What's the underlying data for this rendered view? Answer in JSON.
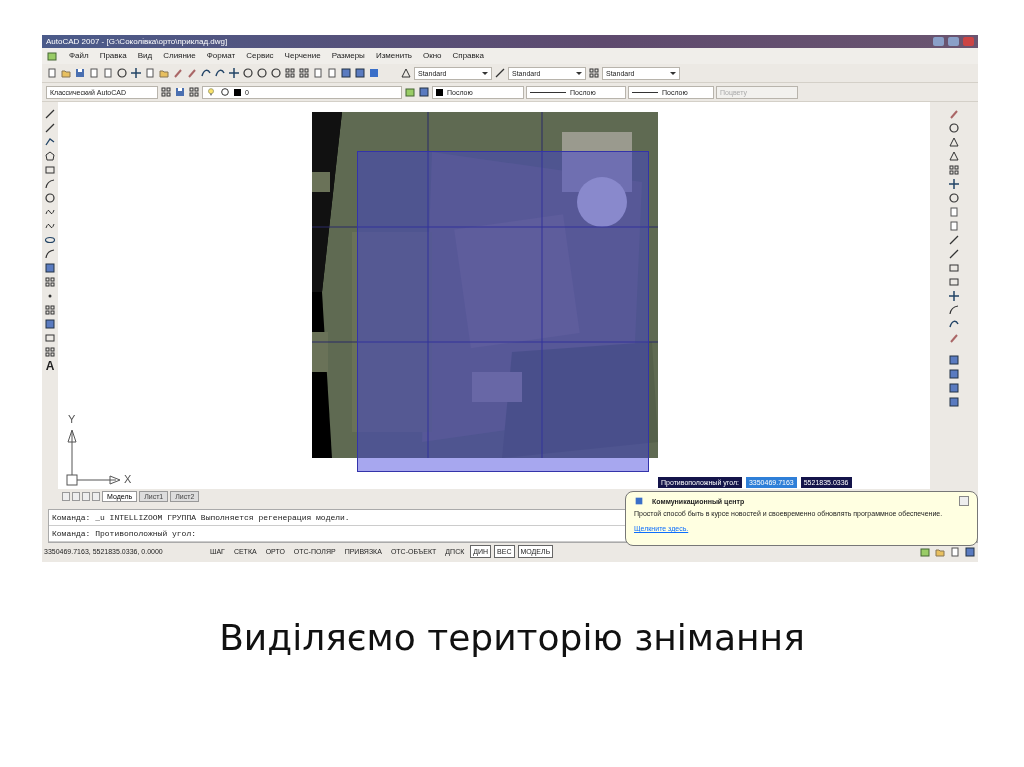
{
  "window": {
    "title": "AutoCAD 2007 - [G:\\Соколівка\\орто\\приклад.dwg]"
  },
  "menu": [
    "Файл",
    "Правка",
    "Вид",
    "Слияние",
    "Формат",
    "Сервис",
    "Черчение",
    "Размеры",
    "Изменить",
    "Окно",
    "Справка"
  ],
  "style_dropdowns": [
    "Standard",
    "Standard",
    "Standard"
  ],
  "workspace": "Классический AutoCAD",
  "layer": "0",
  "properties": [
    {
      "kind": "color",
      "value": "Послою",
      "disabled": false
    },
    {
      "kind": "linetype",
      "value": "Послою",
      "disabled": false
    },
    {
      "kind": "lineweight",
      "value": "Послою",
      "disabled": false
    },
    {
      "kind": "plotstyle",
      "value": "Поцвету",
      "disabled": true
    }
  ],
  "draw_toolbar": {
    "text_tool": "A"
  },
  "ucs": {
    "x_label": "X",
    "y_label": "Y"
  },
  "layout_tabs": [
    {
      "label": "Модель",
      "selected": true
    },
    {
      "label": "Лист1",
      "selected": false
    },
    {
      "label": "Лист2",
      "selected": false
    }
  ],
  "command_lines": [
    "Команда:  _u INTELLIZOOM ГРУППА Выполняется регенерация модели.",
    "Команда: Противоположный угол:"
  ],
  "dynamic_input": {
    "prompt": "Противоположный угол:",
    "fields": [
      {
        "value": "3350469.7163",
        "selected": true
      },
      {
        "value": "5521835.0336",
        "selected": false
      }
    ]
  },
  "status_bar": {
    "coordinates": "3350469.7163, 5521835.0336, 0.0000",
    "toggles": [
      {
        "label": "ШАГ",
        "on": false
      },
      {
        "label": "СЕТКА",
        "on": false
      },
      {
        "label": "ОРТО",
        "on": false
      },
      {
        "label": "ОТС-ПОЛЯР",
        "on": false
      },
      {
        "label": "ПРИВЯЗКА",
        "on": false
      },
      {
        "label": "ОТС-ОБЪЕКТ",
        "on": false
      },
      {
        "label": "ДПСК",
        "on": false
      },
      {
        "label": "ДИН",
        "on": true
      },
      {
        "label": "ВЕС",
        "on": true
      },
      {
        "label": "МОДЕЛЬ",
        "on": true
      }
    ]
  },
  "balloon": {
    "title": "Коммуникационный центр",
    "text": "Простой способ быть в курсе новостей и своевременно обновлять программное обеспечение.",
    "link": "Щелкните здесь."
  },
  "caption": "Виділяємо територію знімання"
}
